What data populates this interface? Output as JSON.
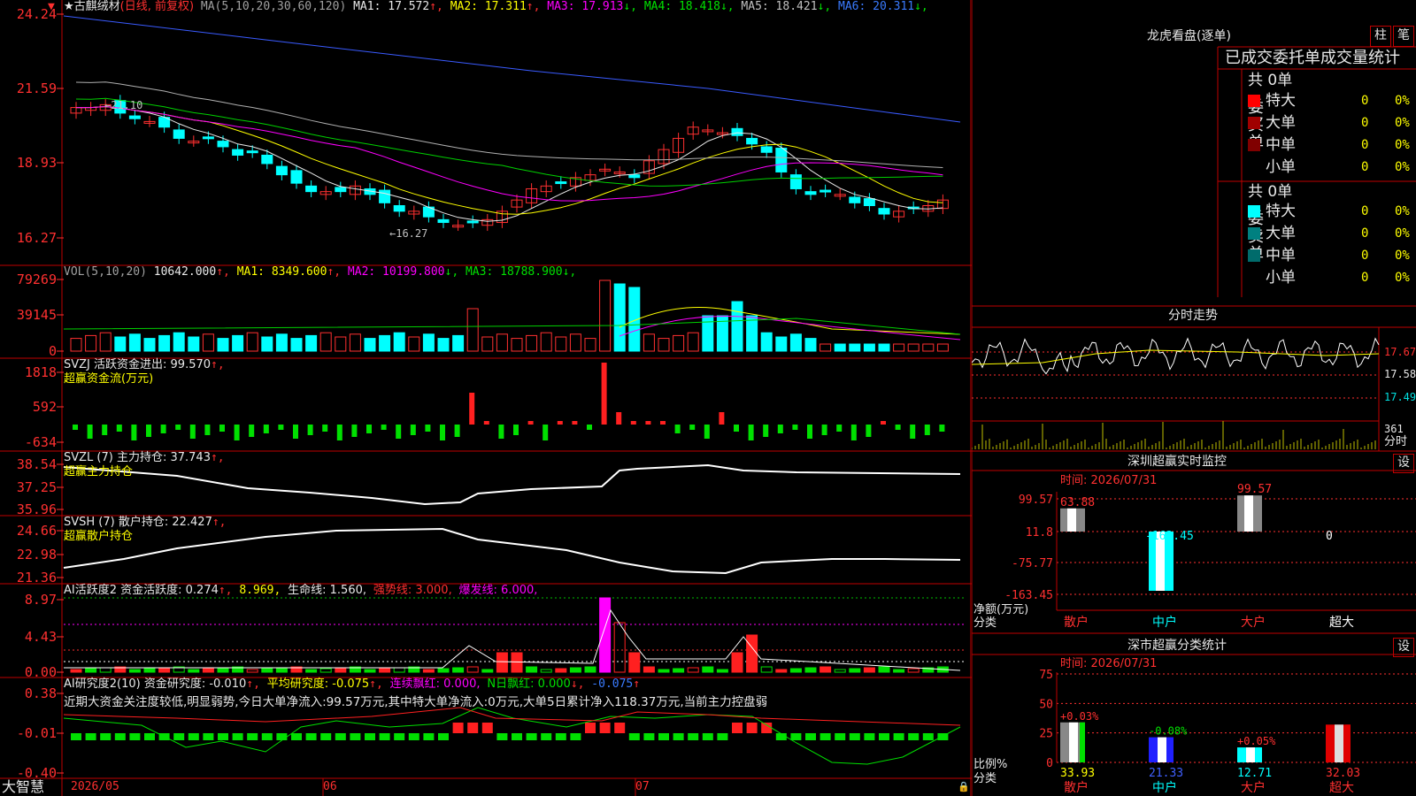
{
  "stock": {
    "name": "★古麒绒材",
    "mode": "(日线, 前复权)"
  },
  "ma": {
    "label": "MA(5,10,20,30,60,120)",
    "items": [
      {
        "text": "MA1: 17.572",
        "arrow": "↑",
        "color": "#e8e8e8"
      },
      {
        "text": "MA2: 17.311",
        "arrow": "↑",
        "color": "#ffff00"
      },
      {
        "text": "MA3: 17.913",
        "arrow": "↓",
        "color": "#ff00ff"
      },
      {
        "text": "MA4: 18.418",
        "arrow": "↓",
        "color": "#00e000"
      },
      {
        "text": "MA5: 18.421",
        "arrow": "↓",
        "color": "#c0c0c0"
      },
      {
        "text": "MA6: 20.311",
        "arrow": "↓",
        "color": "#3a7bff"
      }
    ],
    "y_ticks": [
      "24.24",
      "21.59",
      "18.93",
      "16.27"
    ],
    "annot_high": "21.10",
    "annot_low": "16.27"
  },
  "vol": {
    "label": "VOL(5,10,20)",
    "value": "10642.000",
    "items": [
      {
        "text": "MA1: 8349.600",
        "arrow": "↑",
        "color": "#ffff00"
      },
      {
        "text": "MA2: 10199.800",
        "arrow": "↓",
        "color": "#ff00ff"
      },
      {
        "text": "MA3: 18788.900",
        "arrow": "↓",
        "color": "#00e000"
      }
    ],
    "y_ticks": [
      "79269",
      "39145",
      "0"
    ]
  },
  "svzj": {
    "label": "SVZJ  活跃资金进出: 99.570",
    "arrow": "↑,",
    "sub": "超赢资金流(万元)",
    "y_ticks": [
      "1818",
      "592",
      "-634"
    ]
  },
  "svzl": {
    "label": "SVZL (7) 主力持仓: 37.743",
    "arrow": "↑,",
    "sub": "超赢主力持仓",
    "y_ticks": [
      "38.54",
      "37.25",
      "35.96"
    ]
  },
  "svsh": {
    "label": "SVSH (7) 散户持仓: 22.427",
    "arrow": "↑,",
    "sub": "超赢散户持仓",
    "y_ticks": [
      "24.66",
      "22.98",
      "21.36"
    ]
  },
  "ai1": {
    "label": "AI活跃度2 资金活跃度: 0.274",
    "v2": "8.969,",
    "v3": "生命线: 1.560,",
    "v4": "强势线: 3.000,",
    "v5": "爆发线: 6.000,",
    "y_ticks": [
      "8.97",
      "4.43",
      "0.00"
    ]
  },
  "ai2": {
    "label": "AI研究度2(10) 资金研究度: -0.010",
    "v2": "平均研究度: -0.075",
    "v3": "连续飘红: 0.000,",
    "v4": "N日飘红: 0.000",
    "v5": "-0.075",
    "summary": "近期大资金关注度较低,明显弱势,今日大单净流入:99.57万元,其中特大单净流入:0万元,大单5日累计净入118.37万元,当前主力控盘弱",
    "y_ticks": [
      "0.38",
      "-0.01",
      "-0.40"
    ]
  },
  "footer": {
    "brand": "大智慧",
    "dates": [
      "2026/05",
      "06",
      "07"
    ]
  },
  "dragon": {
    "title": "龙虎看盘(逐单)",
    "btn1": "柱",
    "btn2": "笔",
    "header": "已成交委托单成交量统计",
    "buy_label": "委买单",
    "sell_label": "委卖单",
    "buy_total": "共 0单",
    "sell_total": "共 0单",
    "buy_rows": [
      {
        "name": "特大",
        "n": "0",
        "p": "0%",
        "color": "#ff0000"
      },
      {
        "name": "大单",
        "n": "0",
        "p": "0%",
        "color": "#a00000"
      },
      {
        "name": "中单",
        "n": "0",
        "p": "0%",
        "color": "#800000"
      },
      {
        "name": "小单",
        "n": "0",
        "p": "0%",
        "color": ""
      }
    ],
    "sell_rows": [
      {
        "name": "特大",
        "n": "0",
        "p": "0%",
        "color": "#00ffff"
      },
      {
        "name": "大单",
        "n": "0",
        "p": "0%",
        "color": "#008080"
      },
      {
        "name": "中单",
        "n": "0",
        "p": "0%",
        "color": "#006b6b"
      },
      {
        "name": "小单",
        "n": "0",
        "p": "0%",
        "color": ""
      }
    ]
  },
  "intraday": {
    "title": "分时走势",
    "prices": [
      "17.67",
      "17.58",
      "17.49"
    ],
    "vol_max": "361",
    "vol_label": "分时"
  },
  "monitor": {
    "title": "深圳超赢实时监控",
    "set": "设",
    "time": "时间: 2026/07/31",
    "y_ticks": [
      "99.57",
      "11.8",
      "-75.77",
      "-163.45"
    ],
    "unit": "净额(万元)",
    "cat_label": "分类",
    "categories": [
      "散户",
      "中户",
      "大户",
      "超大"
    ],
    "values": [
      63.88,
      -163.45,
      99.57,
      0
    ],
    "value_labels": [
      "63.88",
      "-163.45",
      "99.57",
      "0"
    ]
  },
  "classify": {
    "title": "深市超赢分类统计",
    "set": "设",
    "time": "时间: 2026/07/31",
    "y_ticks": [
      "75",
      "50",
      "25",
      "0"
    ],
    "unit": "比例%",
    "cat_label": "分类",
    "categories": [
      "散户",
      "中户",
      "大户",
      "超大"
    ],
    "values": [
      33.93,
      21.33,
      12.71,
      32.03
    ],
    "changes": [
      "+0.03%",
      "-0.08%",
      "+0.05%",
      ""
    ]
  }
}
